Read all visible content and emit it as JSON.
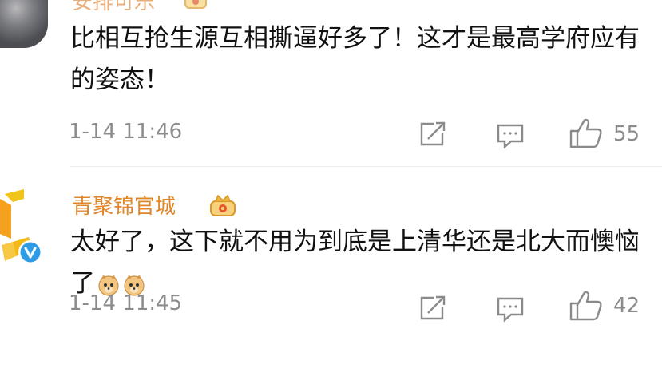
{
  "comments": [
    {
      "username": "安排可乐",
      "text": "比相互抢生源互相撕逼好多了！这才是最高学府应有的姿态！",
      "time": "1-14 11:46",
      "likes": "55"
    },
    {
      "username": "青聚锦官城",
      "text": "太好了，这下就不用为到底是上清华还是北大而懊恼了",
      "time": "1-14 11:45",
      "likes": "42",
      "emojis": [
        "doge-emoji",
        "doge-emoji"
      ]
    }
  ],
  "icons": {
    "share": "share-icon",
    "comment": "comment-icon",
    "like": "thumbs-up-icon",
    "verified": "verified-v-icon",
    "crown": "crown-badge-icon"
  },
  "colors": {
    "username": "#e0862a",
    "meta_text": "#8c8c8c",
    "body_text": "#111111",
    "verified_badge": "#2e9be6"
  }
}
